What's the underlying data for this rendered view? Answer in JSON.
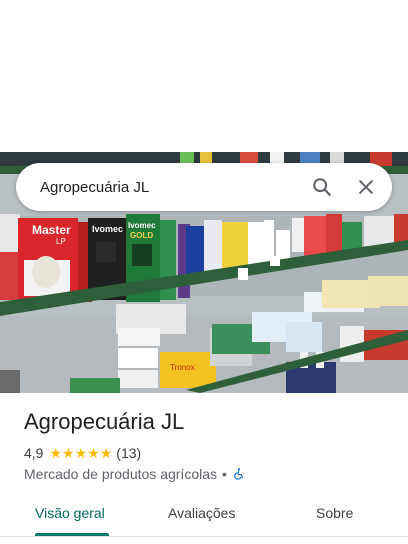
{
  "search": {
    "value": "Agropecuária JL",
    "search_icon": "search-icon",
    "close_icon": "close-icon"
  },
  "photo": {
    "description_icon": "storefront-photo",
    "product_labels": [
      "Master LP",
      "Ivomec",
      "Ivomec Gold"
    ]
  },
  "place": {
    "title": "Agropecuária JL",
    "rating": "4,9",
    "stars": 4.9,
    "review_count": "(13)",
    "category": "Mercado de produtos agrícolas",
    "separator": "•",
    "accessibility_icon": "wheelchair-icon"
  },
  "tabs": [
    {
      "label": "Visão geral",
      "active": true
    },
    {
      "label": "Avaliações",
      "active": false
    },
    {
      "label": "Sobre",
      "active": false
    }
  ],
  "colors": {
    "accent": "#00796b",
    "star": "#fbbc04",
    "accessibility": "#1a73e8"
  }
}
